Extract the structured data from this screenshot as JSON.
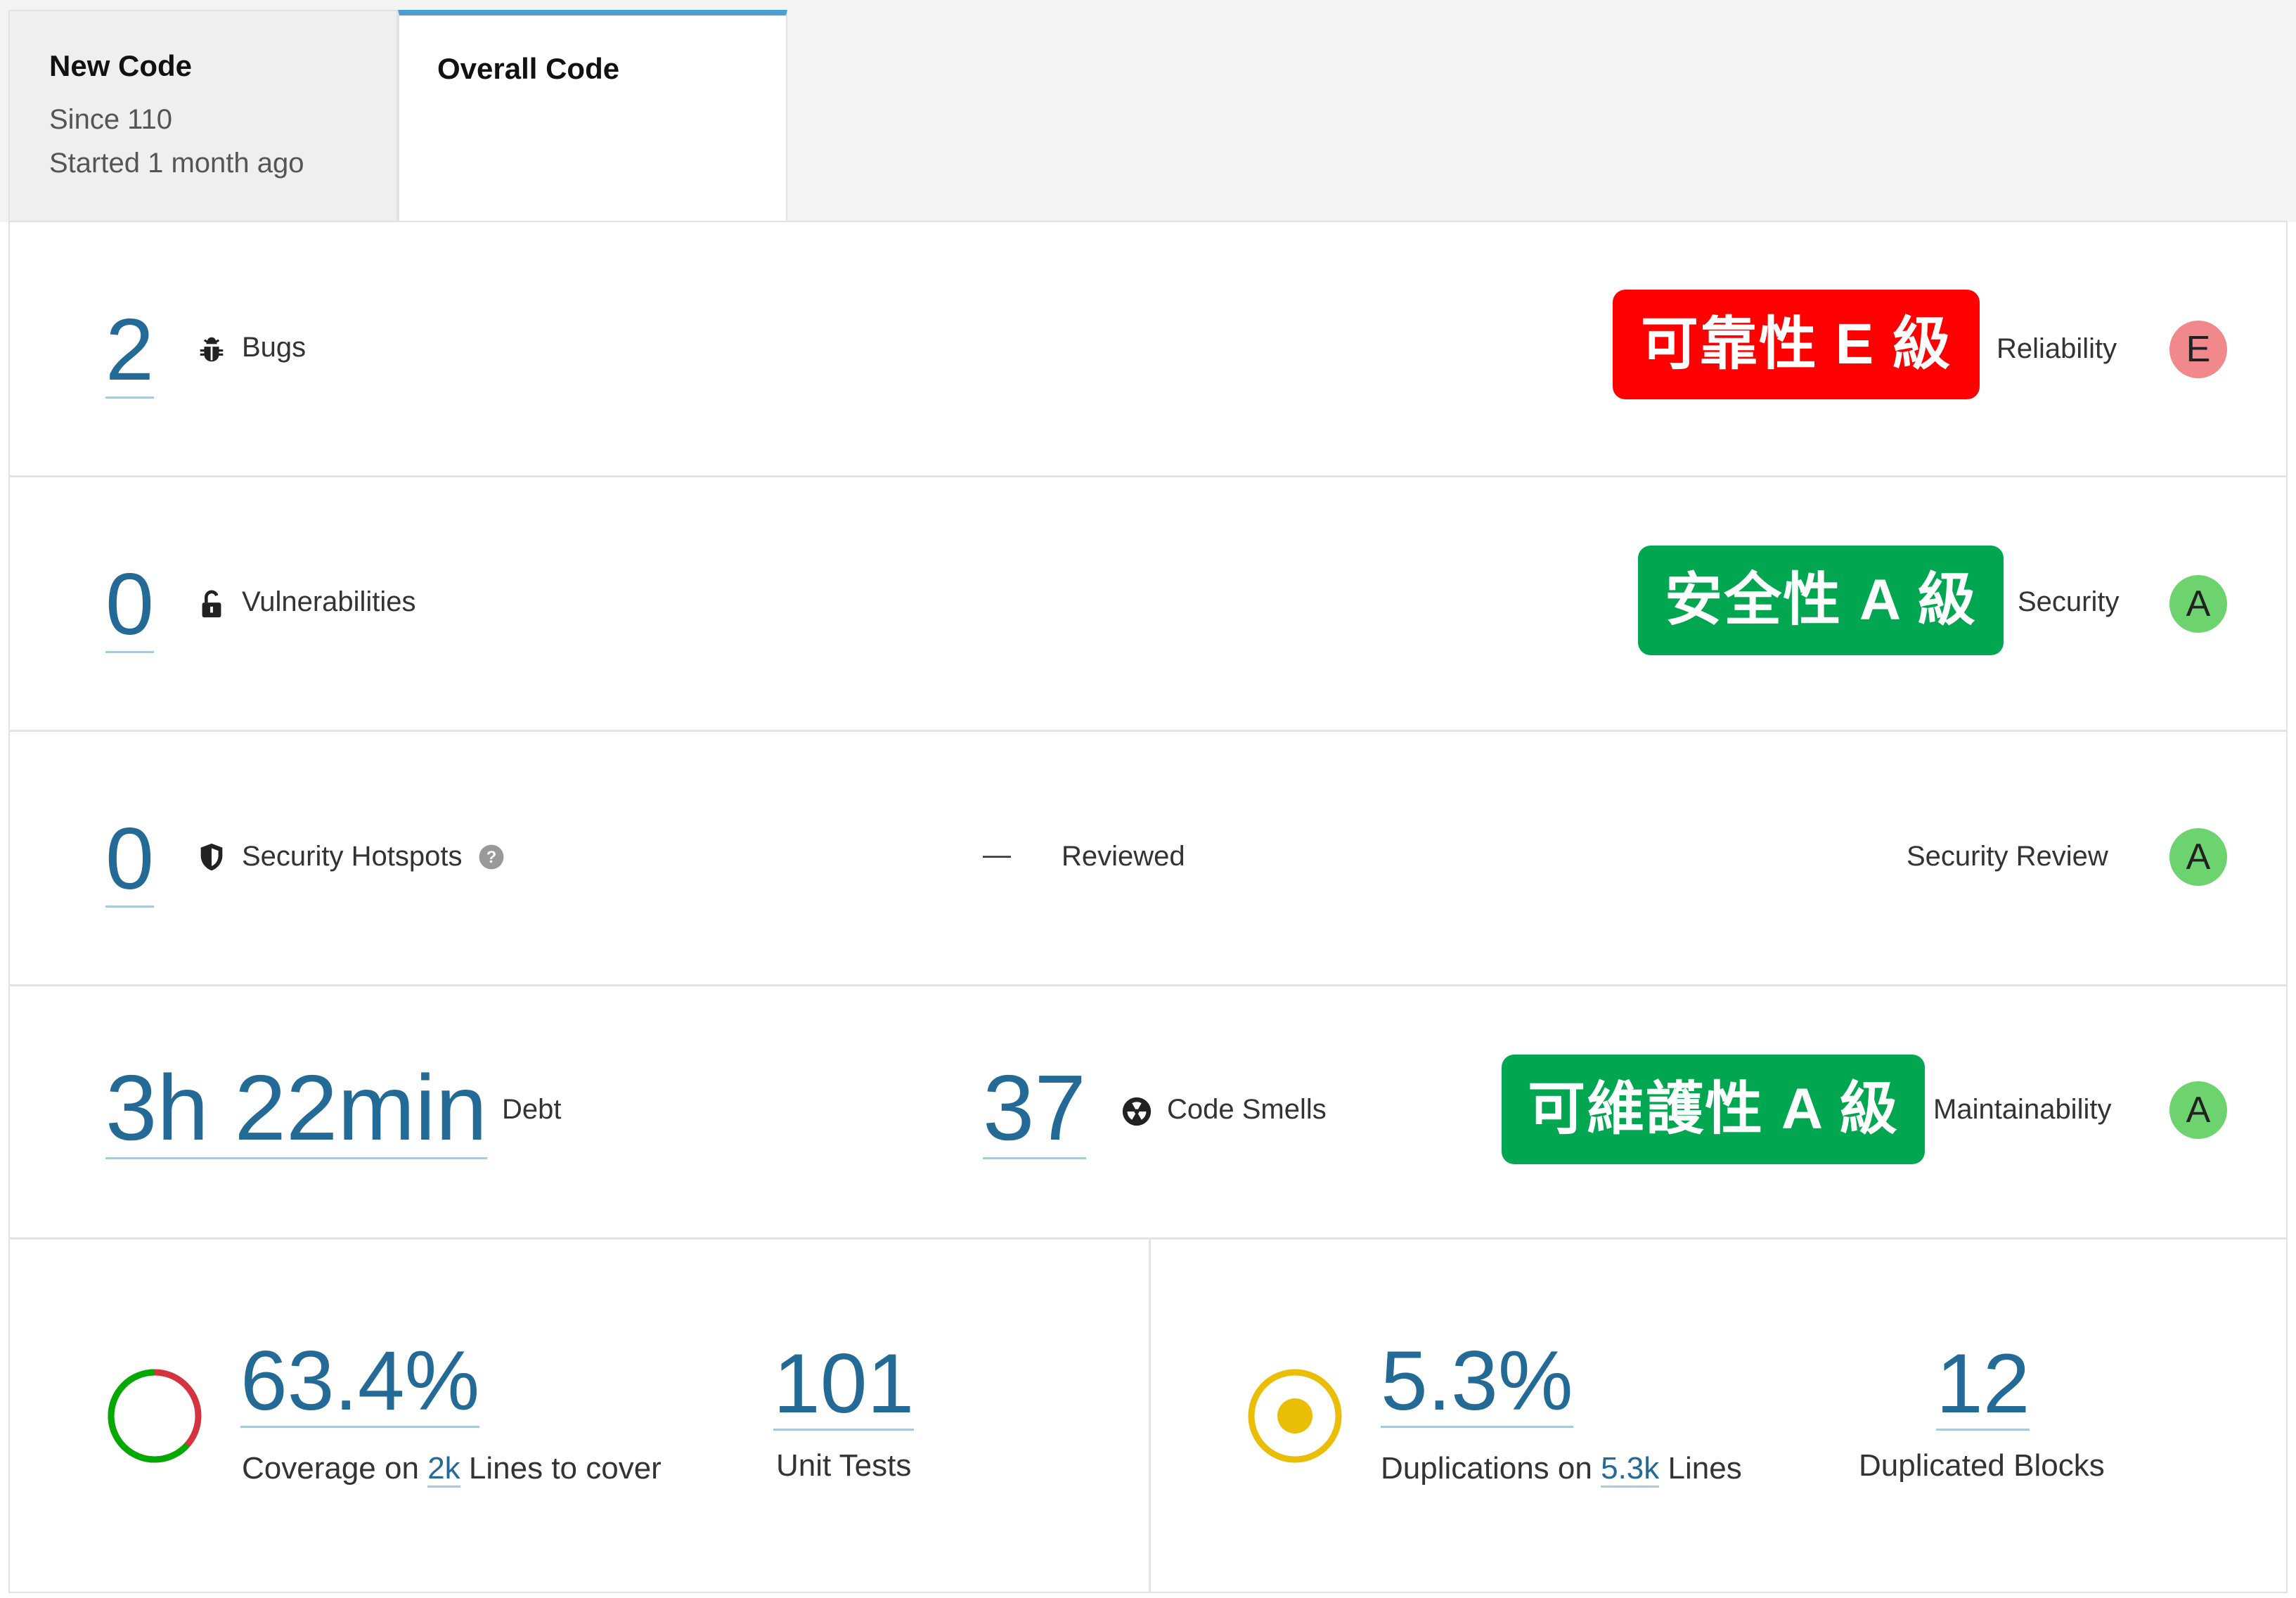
{
  "tabs": {
    "new_code": {
      "title": "New Code",
      "since": "Since 110",
      "started": "Started 1 month ago"
    },
    "overall_code": {
      "title": "Overall Code"
    }
  },
  "reliability": {
    "value": "2",
    "label": "Bugs",
    "icon": "bug-icon",
    "banner": "可靠性 E 級",
    "banner_color": "#ff0000",
    "rating_label": "Reliability",
    "grade": "E",
    "grade_color": "#f0888c"
  },
  "security": {
    "value": "0",
    "label": "Vulnerabilities",
    "icon": "unlock-icon",
    "banner": "安全性 A 級",
    "banner_color": "#00a650",
    "rating_label": "Security",
    "grade": "A",
    "grade_color": "#6dd36f"
  },
  "hotspots": {
    "value": "0",
    "label": "Security Hotspots",
    "icon": "shield-icon",
    "help_icon": "help-icon",
    "reviewed_value": "—",
    "reviewed_label": "Reviewed",
    "rating_label": "Security Review",
    "grade": "A",
    "grade_color": "#6dd36f"
  },
  "maintainability": {
    "debt_value": "3h 22min",
    "debt_label": "Debt",
    "smells_value": "37",
    "smells_label": "Code Smells",
    "icon": "code-smell-icon",
    "banner": "可維護性 A 級",
    "banner_color": "#00a650",
    "rating_label": "Maintainability",
    "grade": "A",
    "grade_color": "#6dd36f"
  },
  "coverage": {
    "value": "63.4%",
    "fraction": 0.634,
    "text_prefix": "Coverage on",
    "lines_value": "2k",
    "text_suffix": "Lines to cover",
    "unit_tests_value": "101",
    "unit_tests_label": "Unit Tests",
    "covered_color": "#00aa00",
    "uncovered_color": "#d4333f"
  },
  "duplications": {
    "value": "5.3%",
    "text_prefix": "Duplications on",
    "lines_value": "5.3k",
    "text_suffix": "Lines",
    "blocks_value": "12",
    "blocks_label": "Duplicated Blocks",
    "indicator_color": "#eabe06"
  }
}
